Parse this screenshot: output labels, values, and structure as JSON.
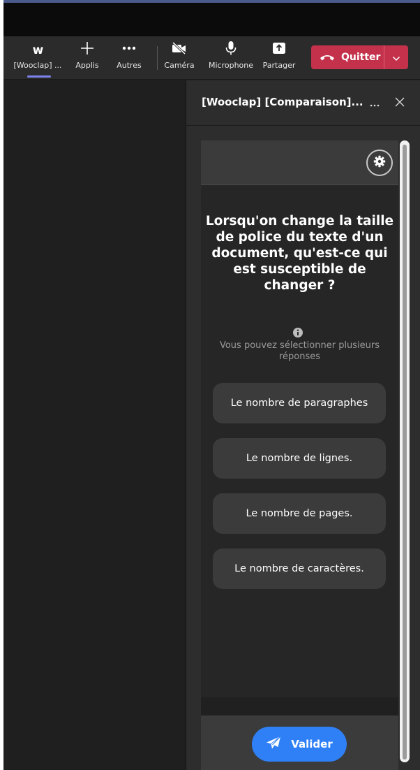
{
  "toolbar": {
    "items": [
      {
        "label": "[Wooclap] ...",
        "icon": "wooclap-w-icon",
        "logo_text": "w"
      },
      {
        "label": "Applis",
        "icon": "plus-icon"
      },
      {
        "label": "Autres",
        "icon": "more-icon"
      },
      {
        "label": "Caméra",
        "icon": "camera-off-icon"
      },
      {
        "label": "Microphone",
        "icon": "microphone-icon"
      },
      {
        "label": "Partager",
        "icon": "share-icon"
      }
    ],
    "quit_label": "Quitter",
    "quit_color": "#c4314b",
    "active_color": "#7b83eb"
  },
  "panel": {
    "title": "[Wooclap] [Comparaison]...",
    "more_icon": "ellipsis-icon",
    "close_icon": "close-icon"
  },
  "question": {
    "text": "Lorsqu'on change la taille de police du texte d'un document, qu'est-ce qui est susceptible de changer ?",
    "hint": "Vous pouvez sélectionner plusieurs réponses",
    "answers": [
      "Le nombre de paragraphes",
      "Le nombre de lignes.",
      "Le nombre de pages.",
      "Le nombre de caractères."
    ]
  },
  "footer": {
    "submit_label": "Valider",
    "submit_icon": "paper-plane-icon",
    "submit_color": "#2f80f7"
  }
}
